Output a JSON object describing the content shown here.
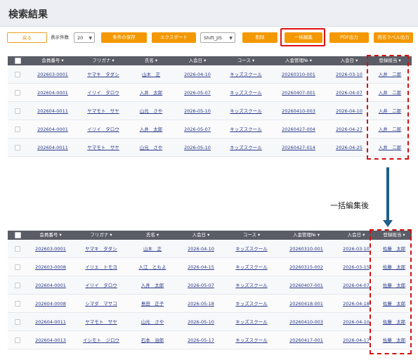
{
  "page": {
    "title": "検索結果"
  },
  "toolbar": {
    "back_label": "戻る",
    "count_label": "表示件数",
    "count_value": "20",
    "save_label": "条件の保存",
    "export_label": "エクスポート",
    "encoding_value": "Shift_JIS",
    "delete_label": "削除",
    "bulk_edit_label": "一括編集",
    "pdf_label": "PDF出力",
    "address_label": "宛名ラベル出力"
  },
  "columns": [
    "会員番号 ▾",
    "フリガナ ▾",
    "氏名 ▾",
    "入会日 ▾",
    "コース ▾",
    "入金管理№ ▾",
    "入会日 ▾",
    "登録担当 ▾"
  ],
  "top_table": {
    "rows": [
      [
        "202603-0001",
        "ヤマキ　タダシ",
        "山木　正",
        "2026-04-10",
        "キッズスクール",
        "20260310-001",
        "2026-03-10",
        "入井　二郎"
      ],
      [
        "202604-0001",
        "イリイ　タロウ",
        "入井　太郎",
        "2026-05-07",
        "キッズスクール",
        "20260407-001",
        "2026-04-07",
        "入井　二郎"
      ],
      [
        "202604-0011",
        "ヤマモト　サヤ",
        "山元　さや",
        "2026-05-10",
        "キッズスクール",
        "20260410-003",
        "2026-04-10",
        "入井　二郎"
      ],
      [
        "202604-0001",
        "イリイ　タロウ",
        "入井　太郎",
        "2026-05-07",
        "キッズスクール",
        "20260427-004",
        "2026-04-27",
        "入井　二郎"
      ],
      [
        "202604-0011",
        "ヤマモト　サヤ",
        "山元　さや",
        "2026-05-10",
        "キッズスクール",
        "20260427-014",
        "2026-04-25",
        "入井　二郎"
      ]
    ]
  },
  "after_label": "一括編集後",
  "bottom_table": {
    "rows": [
      [
        "202603-0001",
        "ヤマキ　タダシ",
        "山木　正",
        "2026-04-10",
        "キッズスクール",
        "20260310-001",
        "2026-03-10",
        "佐藤　太郎"
      ],
      [
        "202603-0008",
        "イリエ　トモヨ",
        "入江　ともよ",
        "2026-04-15",
        "キッズスクール",
        "20260315-002",
        "2026-03-15",
        "佐藤　太郎"
      ],
      [
        "202604-0001",
        "イリイ　タロウ",
        "入井　太郎",
        "2026-05-07",
        "キッズスクール",
        "20260407-001",
        "2026-04-07",
        "佐藤　太郎"
      ],
      [
        "202604-0008",
        "シマダ　マサコ",
        "島田　正子",
        "2026-05-18",
        "キッズスクール",
        "20260418-001",
        "2026-04-18",
        "佐藤　太郎"
      ],
      [
        "202604-0011",
        "ヤマモト　サヤ",
        "山元　さや",
        "2026-05-10",
        "キッズスクール",
        "20260410-003",
        "2026-04-10",
        "佐藤　太郎"
      ],
      [
        "202604-0013",
        "イシモト　ジロウ",
        "石本　治郎",
        "2026-05-17",
        "キッズスクール",
        "20260417-001",
        "2026-04-17",
        "佐藤　太郎"
      ]
    ]
  },
  "colors": {
    "accent": "#f39800",
    "header_bg": "#5a5d66",
    "highlight": "#e01010",
    "arrow": "#1f5f8b"
  }
}
